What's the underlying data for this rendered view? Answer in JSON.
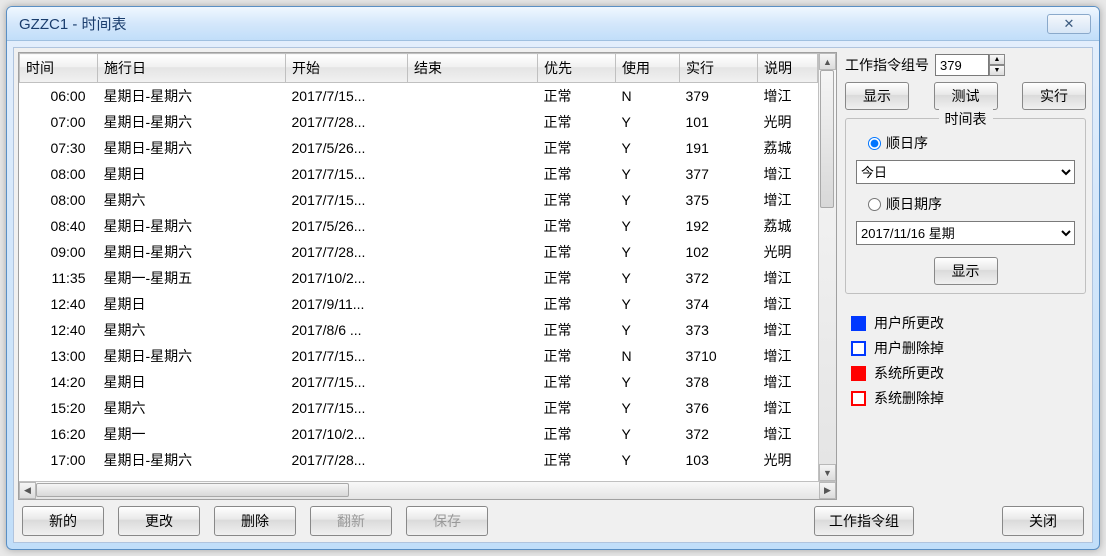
{
  "window": {
    "title": "GZZC1 - 时间表"
  },
  "table": {
    "headers": {
      "time": "时间",
      "day": "施行日",
      "start": "开始",
      "end": "结束",
      "priority": "优先",
      "use": "使用",
      "exec": "实行",
      "desc": "说明"
    },
    "rows": [
      {
        "time": "06:00",
        "day": "星期日-星期六",
        "start": "2017/7/15...",
        "end": "",
        "priority": "正常",
        "use": "N",
        "exec": "379",
        "desc": "增江"
      },
      {
        "time": "07:00",
        "day": "星期日-星期六",
        "start": "2017/7/28...",
        "end": "",
        "priority": "正常",
        "use": "Y",
        "exec": "101",
        "desc": "光明"
      },
      {
        "time": "07:30",
        "day": "星期日-星期六",
        "start": "2017/5/26...",
        "end": "",
        "priority": "正常",
        "use": "Y",
        "exec": "191",
        "desc": "荔城"
      },
      {
        "time": "08:00",
        "day": "星期日",
        "start": "2017/7/15...",
        "end": "",
        "priority": "正常",
        "use": "Y",
        "exec": "377",
        "desc": "增江"
      },
      {
        "time": "08:00",
        "day": "星期六",
        "start": "2017/7/15...",
        "end": "",
        "priority": "正常",
        "use": "Y",
        "exec": "375",
        "desc": "增江"
      },
      {
        "time": "08:40",
        "day": "星期日-星期六",
        "start": "2017/5/26...",
        "end": "",
        "priority": "正常",
        "use": "Y",
        "exec": "192",
        "desc": "荔城"
      },
      {
        "time": "09:00",
        "day": "星期日-星期六",
        "start": "2017/7/28...",
        "end": "",
        "priority": "正常",
        "use": "Y",
        "exec": "102",
        "desc": "光明"
      },
      {
        "time": "11:35",
        "day": "星期一-星期五",
        "start": "2017/10/2...",
        "end": "",
        "priority": "正常",
        "use": "Y",
        "exec": "372",
        "desc": "增江"
      },
      {
        "time": "12:40",
        "day": "星期日",
        "start": "2017/9/11...",
        "end": "",
        "priority": "正常",
        "use": "Y",
        "exec": "374",
        "desc": "增江"
      },
      {
        "time": "12:40",
        "day": "星期六",
        "start": "2017/8/6 ...",
        "end": "",
        "priority": "正常",
        "use": "Y",
        "exec": "373",
        "desc": "增江"
      },
      {
        "time": "13:00",
        "day": "星期日-星期六",
        "start": "2017/7/15...",
        "end": "",
        "priority": "正常",
        "use": "N",
        "exec": "3710",
        "desc": "增江"
      },
      {
        "time": "14:20",
        "day": "星期日",
        "start": "2017/7/15...",
        "end": "",
        "priority": "正常",
        "use": "Y",
        "exec": "378",
        "desc": "增江"
      },
      {
        "time": "15:20",
        "day": "星期六",
        "start": "2017/7/15...",
        "end": "",
        "priority": "正常",
        "use": "Y",
        "exec": "376",
        "desc": "增江"
      },
      {
        "time": "16:20",
        "day": "星期一",
        "start": "2017/10/2...",
        "end": "",
        "priority": "正常",
        "use": "Y",
        "exec": "372",
        "desc": "增江"
      },
      {
        "time": "17:00",
        "day": "星期日-星期六",
        "start": "2017/7/28...",
        "end": "",
        "priority": "正常",
        "use": "Y",
        "exec": "103",
        "desc": "光明"
      }
    ]
  },
  "side": {
    "group_no_label": "工作指令组号",
    "group_no_value": "379",
    "show_btn": "显示",
    "test_btn": "测试",
    "exec_btn": "实行",
    "timetable_title": "时间表",
    "radio_day_order": "顺日序",
    "radio_date_order": "顺日期序",
    "combo_today": "今日",
    "combo_date": "2017/11/16 星期",
    "show_btn2": "显示"
  },
  "legend": {
    "user_changed": "用户所更改",
    "user_deleted": "用户删除掉",
    "system_changed": "系统所更改",
    "system_deleted": "系统删除掉"
  },
  "bottom": {
    "new": "新的",
    "edit": "更改",
    "delete": "删除",
    "refresh": "翻新",
    "save": "保存",
    "work_group": "工作指令组",
    "close": "关闭"
  }
}
